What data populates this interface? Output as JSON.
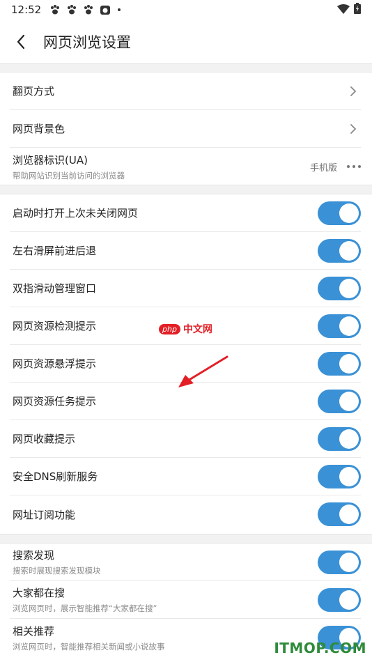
{
  "status_bar": {
    "time": "12:52"
  },
  "header": {
    "title": "网页浏览设置"
  },
  "group1": [
    {
      "label": "翻页方式"
    },
    {
      "label": "网页背景色"
    },
    {
      "label": "浏览器标识(UA)",
      "sub": "帮助网站识别当前访问的浏览器",
      "value": "手机版"
    }
  ],
  "group2": [
    {
      "label": "启动时打开上次未关闭网页",
      "on": true
    },
    {
      "label": "左右滑屏前进后退",
      "on": true
    },
    {
      "label": "双指滑动管理窗口",
      "on": true
    },
    {
      "label": "网页资源检测提示",
      "on": true
    },
    {
      "label": "网页资源悬浮提示",
      "on": true
    },
    {
      "label": "网页资源任务提示",
      "on": true
    },
    {
      "label": "网页收藏提示",
      "on": true
    },
    {
      "label": "安全DNS刷新服务",
      "on": true
    },
    {
      "label": "网址订阅功能",
      "on": true
    }
  ],
  "group3": [
    {
      "label": "搜索发现",
      "sub": "搜索时展现搜索发现模块",
      "on": true
    },
    {
      "label": "大家都在搜",
      "sub": "浏览网页时，展示智能推荐“大家都在搜”",
      "on": true
    },
    {
      "label": "相关推荐",
      "sub": "浏览网页时，智能推荐相关新闻或小说故事",
      "on": true
    }
  ],
  "watermarks": {
    "php_badge": "php",
    "php_text": "中文网",
    "itmop": "ITMOP.COM"
  },
  "colors": {
    "toggle_on": "#3a91d6",
    "arrow": "#e31f26"
  }
}
